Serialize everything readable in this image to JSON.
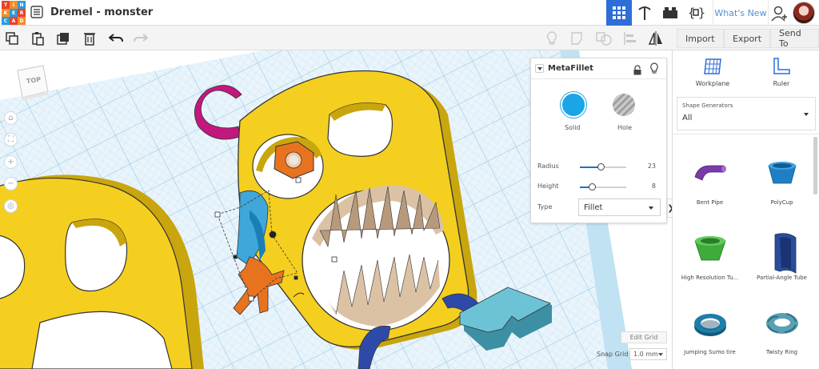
{
  "app": {
    "logo_letters": [
      "T",
      "I",
      "N",
      "K",
      "E",
      "R",
      "C",
      "A",
      "D"
    ],
    "logo_colors": [
      "#e8422a",
      "#f28d2a",
      "#2e9ad8",
      "#f28d2a",
      "#2e9ad8",
      "#e8422a",
      "#2e9ad8",
      "#e8422a",
      "#f28d2a"
    ],
    "design_title": "Dremel - monster",
    "whats_new": "What's New",
    "accent_color": "#2e6ed9"
  },
  "top_icons": [
    "3d-design-grid-icon",
    "pickaxe-icon",
    "bricks-icon",
    "codeblocks-icon"
  ],
  "toolbar": {
    "import_label": "Import",
    "export_label": "Export",
    "send_to_label": "Send To"
  },
  "viewcube": {
    "label": "TOP"
  },
  "inspector": {
    "title": "MetaFillet",
    "solid_label": "Solid",
    "hole_label": "Hole",
    "solid_color": "#1aa5e6",
    "properties": [
      {
        "label": "Radius",
        "value": "23",
        "level": 0.45
      },
      {
        "label": "Height",
        "value": "8",
        "level": 0.25
      }
    ],
    "type_label": "Type",
    "type_value": "Fillet"
  },
  "grid": {
    "edit_grid_label": "Edit Grid",
    "snap_grid_label": "Snap Grid",
    "snap_grid_value": "1.0 mm"
  },
  "library": {
    "workplane_label": "Workplane",
    "ruler_label": "Ruler",
    "generators_title": "Shape Generators",
    "generators_value": "All",
    "shapes": [
      {
        "label": "Bent Pipe",
        "icon": "bent-pipe-icon",
        "color": "#7a3aa8"
      },
      {
        "label": "PolyCup",
        "icon": "polycup-icon",
        "color": "#1f7ec4"
      },
      {
        "label": "High Resolution Tu...",
        "icon": "high-resolution-tube-icon",
        "color": "#3eab3a"
      },
      {
        "label": "Partial-Angle Tube",
        "icon": "partial-angle-tube-icon",
        "color": "#2a4d9a"
      },
      {
        "label": "Jumping Sumo tire",
        "icon": "jumping-sumo-tire-icon",
        "color": "#1f7ea8"
      },
      {
        "label": "Twisty Ring",
        "icon": "twisty-ring-icon",
        "color": "#5aa0b5"
      }
    ]
  },
  "scene_colors": {
    "grid": "#c9e3f3",
    "monster_yellow": "#f5cf1f",
    "mouth_tan": "#dcc2a5",
    "fillet_orange": "#e8731f",
    "hook_magenta": "#c2187e",
    "arc_blue": "#2e4aa8",
    "teal_shape": "#5fb5c8"
  }
}
